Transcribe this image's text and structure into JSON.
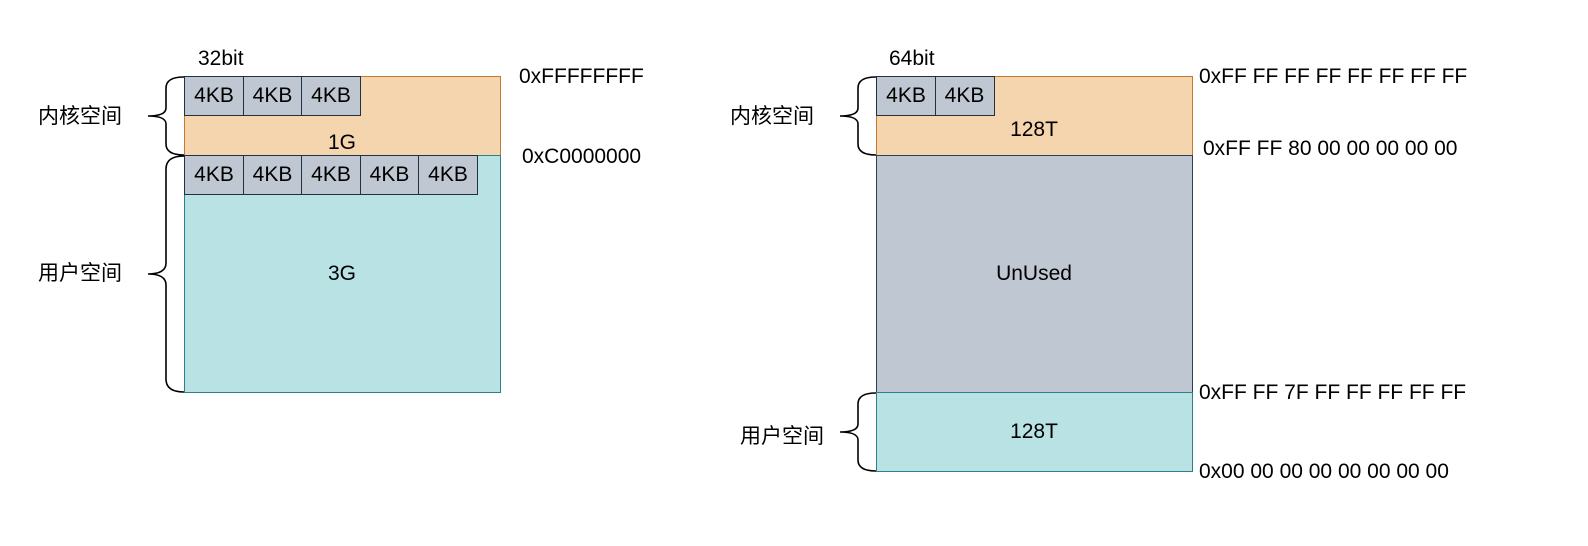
{
  "left": {
    "bits_label": "32bit",
    "kernel_label": "内核空间",
    "user_label": "用户空间",
    "kernel_size": "1G",
    "user_size": "3G",
    "kernel_pages": [
      "4KB",
      "4KB",
      "4KB"
    ],
    "user_pages": [
      "4KB",
      "4KB",
      "4KB",
      "4KB",
      "4KB"
    ],
    "addr_top": "0xFFFFFFFF",
    "addr_boundary": "0xC0000000"
  },
  "right": {
    "bits_label": "64bit",
    "kernel_label": "内核空间",
    "user_label": "用户空间",
    "kernel_size": "128T",
    "unused_label": "UnUsed",
    "user_size": "128T",
    "kernel_pages": [
      "4KB",
      "4KB"
    ],
    "addr_top": "0xFF FF FF FF FF FF FF FF",
    "addr_kernel_start": "0xFF FF 80 00 00 00 00 00",
    "addr_user_end": "0xFF FF 7F FF FF FF FF FF",
    "addr_bottom": "0x00 00 00 00 00 00 00 00"
  },
  "colors": {
    "kernel_fill": "#f5d5ad",
    "user_fill": "#b8e2e4",
    "unused_fill": "#bfc8d2",
    "page_fill": "#bfc8d2"
  }
}
